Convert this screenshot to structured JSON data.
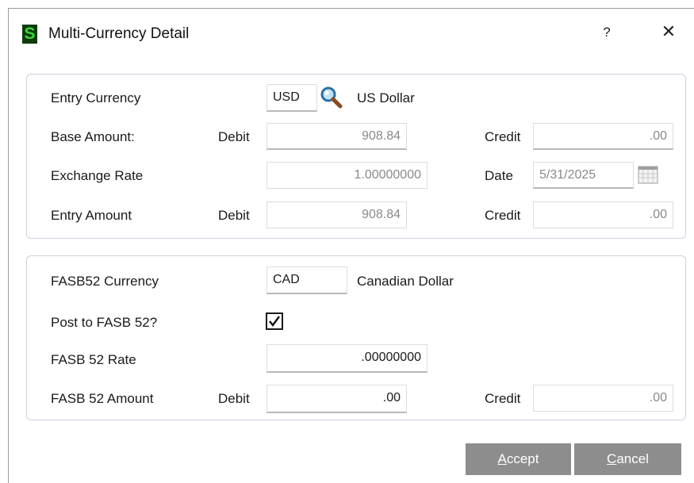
{
  "window": {
    "icon_letter": "S",
    "title": "Multi-Currency Detail",
    "help": "?",
    "close": "✕"
  },
  "entry_group": {
    "entry_currency": {
      "label": "Entry Currency",
      "code": "USD",
      "name": "US Dollar",
      "lookup_icon": "magnifier-icon"
    },
    "base_amount": {
      "label": "Base Amount:",
      "debit_label": "Debit",
      "debit": "908.84",
      "credit_label": "Credit",
      "credit": ".00"
    },
    "exchange_rate": {
      "label": "Exchange Rate",
      "value": "1.00000000",
      "date_label": "Date",
      "date": "5/31/2025",
      "calendar_icon": "calendar-icon"
    },
    "entry_amount": {
      "label": "Entry Amount",
      "debit_label": "Debit",
      "debit": "908.84",
      "credit_label": "Credit",
      "credit": ".00"
    }
  },
  "fasb_group": {
    "fasb_currency": {
      "label": "FASB52 Currency",
      "code": "CAD",
      "name": "Canadian Dollar"
    },
    "post_to_fasb": {
      "label": "Post to FASB 52?",
      "checked": true
    },
    "fasb_rate": {
      "label": "FASB 52 Rate",
      "value": ".00000000"
    },
    "fasb_amount": {
      "label": "FASB 52 Amount",
      "debit_label": "Debit",
      "debit": ".00",
      "credit_label": "Credit",
      "credit": ".00"
    }
  },
  "buttons": {
    "accept_mnemonic": "A",
    "accept_rest": "ccept",
    "cancel_mnemonic": "C",
    "cancel_rest": "ancel"
  },
  "colors": {
    "button_bg": "#8d8d8d",
    "icon_bg": "#0d3b0d",
    "icon_fg": "#3bd63b",
    "group_border": "#c9d3dd"
  }
}
